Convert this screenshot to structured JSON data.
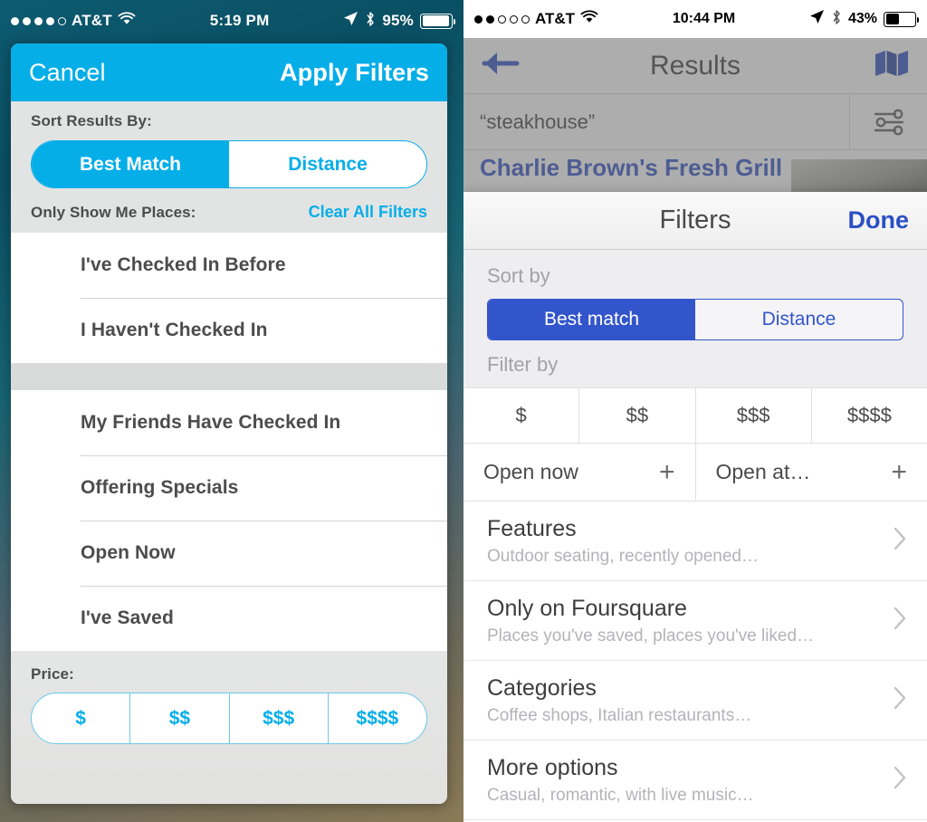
{
  "left": {
    "status_bar": {
      "signal_dots_filled": 4,
      "signal_dots_total": 5,
      "carrier": "AT&T",
      "wifi_icon": "wifi-icon",
      "time": "5:19 PM",
      "location_icon": "location-arrow-icon",
      "bluetooth_icon": "bluetooth-icon",
      "battery_percent": "95%",
      "battery_level": 95
    },
    "navbar": {
      "cancel_label": "Cancel",
      "apply_label": "Apply Filters"
    },
    "sort": {
      "label": "Sort Results By:",
      "options": [
        "Best Match",
        "Distance"
      ],
      "selected": "Best Match"
    },
    "only_show": {
      "label": "Only Show Me Places:",
      "clear_label": "Clear All Filters"
    },
    "filter_group_1": [
      "I've Checked In Before",
      "I Haven't Checked In"
    ],
    "filter_group_2": [
      "My Friends Have Checked In",
      "Offering Specials",
      "Open Now",
      "I've Saved"
    ],
    "price": {
      "label": "Price:",
      "options": [
        "$",
        "$$",
        "$$$",
        "$$$$"
      ]
    },
    "colors": {
      "accent": "#06AEE8",
      "panel_bg": "#e2e4e4",
      "text": "#4c4c4c"
    }
  },
  "right": {
    "status_bar": {
      "signal_dots_filled": 2,
      "signal_dots_total": 5,
      "carrier": "AT&T",
      "wifi_icon": "wifi-icon",
      "time": "10:44 PM",
      "location_icon": "location-arrow-icon",
      "bluetooth_icon": "bluetooth-icon",
      "battery_percent": "43%",
      "battery_level": 43
    },
    "navbar": {
      "back_icon": "back-arrow-icon",
      "title": "Results",
      "map_icon": "map-icon"
    },
    "search": {
      "query": "“steakhouse”",
      "filter_icon": "sliders-icon"
    },
    "result_behind": {
      "name": "Charlie Brown's Fresh Grill"
    },
    "sheet": {
      "title": "Filters",
      "done_label": "Done",
      "sort_label": "Sort by",
      "sort_options": [
        "Best match",
        "Distance"
      ],
      "sort_selected": "Best match",
      "filter_label": "Filter by",
      "price_options": [
        "$",
        "$$",
        "$$$",
        "$$$$"
      ],
      "open_cells": [
        {
          "label": "Open now",
          "icon": "plus-icon"
        },
        {
          "label": "Open at…",
          "icon": "plus-icon"
        }
      ],
      "disclosure_rows": [
        {
          "title": "Features",
          "subtitle": "Outdoor seating, recently opened…",
          "icon": "chevron-right-icon"
        },
        {
          "title": "Only on Foursquare",
          "subtitle": "Places you've saved, places you've liked…",
          "icon": "chevron-right-icon"
        },
        {
          "title": "Categories",
          "subtitle": "Coffee shops, Italian restaurants…",
          "icon": "chevron-right-icon"
        },
        {
          "title": "More options",
          "subtitle": "Casual, romantic, with live music…",
          "icon": "chevron-right-icon"
        }
      ]
    },
    "colors": {
      "accent": "#3355cc",
      "sheet_bg": "#ffffff",
      "text": "#3d3d3d"
    }
  }
}
